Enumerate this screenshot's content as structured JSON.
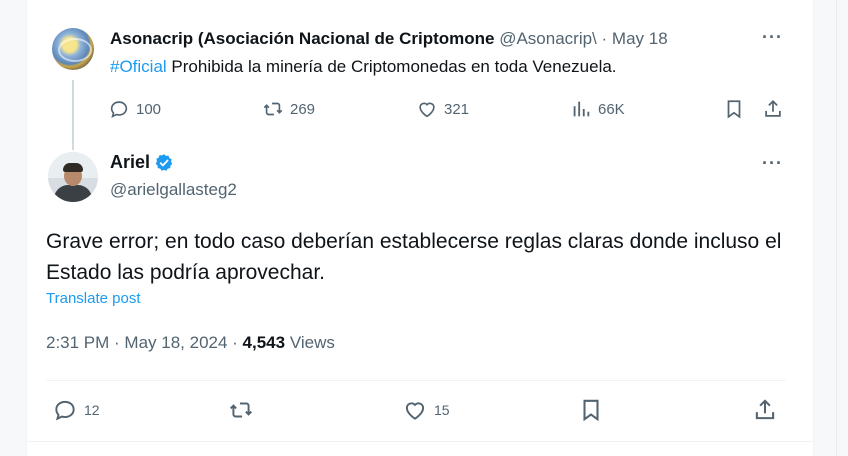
{
  "quoted_tweet": {
    "display_name": "Asonacrip (Asociación Nacional de Criptomone",
    "handle": "@Asonacrip\\",
    "separator": "·",
    "date": "May 18",
    "more": "···",
    "hashtag": "#Oficial",
    "text": " Prohibida la minería de Criptomonedas en toda Venezuela.",
    "stats": {
      "replies": "100",
      "reposts": "269",
      "likes": "321",
      "views": "66K"
    }
  },
  "reply_tweet": {
    "display_name": "Ariel",
    "handle": "@arielgallasteg2",
    "more": "···",
    "body": "Grave error; en todo caso deberían establecerse reglas claras donde incluso el Estado las podría aprovechar.",
    "translate": "Translate post",
    "time": "2:31 PM · May 18, 2024 · ",
    "views_count": "4,543",
    "views_label": " Views",
    "actions": {
      "replies": "12",
      "reposts": "",
      "likes": "15"
    }
  },
  "colors": {
    "accent": "#1d9bf0",
    "text": "#0f1419",
    "secondary": "#536471"
  }
}
